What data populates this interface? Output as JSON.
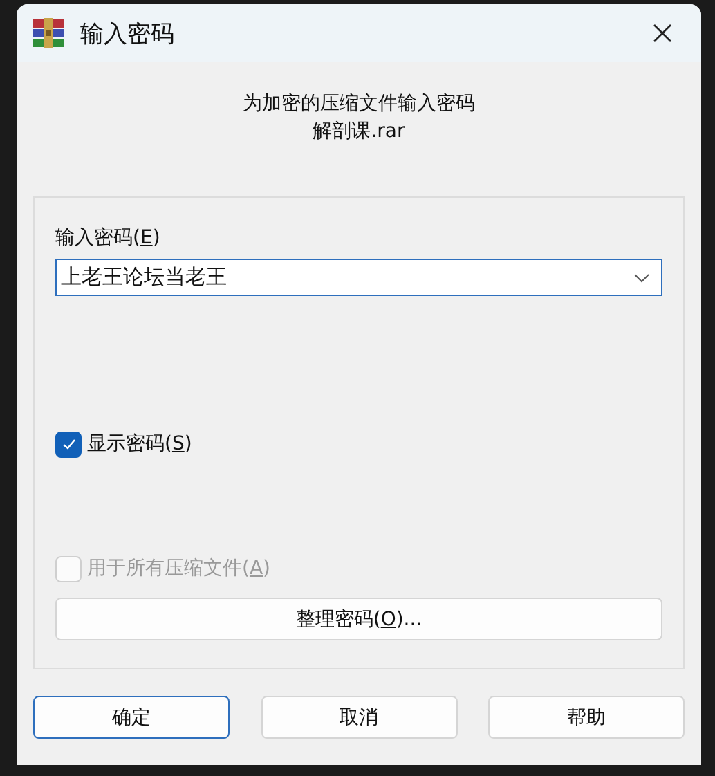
{
  "window": {
    "title": "输入密码"
  },
  "header": {
    "lines": [
      "为加密的压缩文件输入密码",
      "解剖课.rar"
    ]
  },
  "password": {
    "label": {
      "before": "输入密码(",
      "key": "E",
      "after": ")"
    },
    "value": "上老王论坛当老王"
  },
  "checkboxes": [
    {
      "label": {
        "before": "显示密码(",
        "key": "S",
        "after": ")"
      },
      "checked": true,
      "disabled": false
    },
    {
      "label": {
        "before": "用于所有压缩文件(",
        "key": "A",
        "after": ")"
      },
      "checked": false,
      "disabled": true
    }
  ],
  "organize_button": {
    "label": {
      "before": "整理密码(",
      "key": "O",
      "after": ")..."
    }
  },
  "buttons": [
    {
      "label": "确定",
      "default": true
    },
    {
      "label": "取消",
      "default": false
    },
    {
      "label": "帮助",
      "default": false
    }
  ]
}
